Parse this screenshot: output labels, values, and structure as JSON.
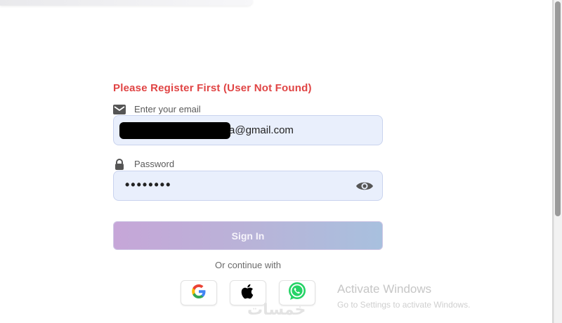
{
  "error_message": "Please Register First (User Not Found)",
  "email": {
    "label": "Enter your email",
    "icon": "mail-icon",
    "value_visible": "a@gmail.com"
  },
  "password": {
    "label": "Password",
    "icon": "lock-icon",
    "value": "••••••••",
    "toggle_icon": "eye-icon"
  },
  "signin_label": "Sign In",
  "or_text": "Or continue with",
  "social": [
    {
      "name": "google",
      "icon": "google-icon"
    },
    {
      "name": "apple",
      "icon": "apple-icon"
    },
    {
      "name": "whatsapp",
      "icon": "whatsapp-icon"
    }
  ],
  "windows_activation": {
    "title": "Activate Windows",
    "subtitle": "Go to Settings to activate Windows."
  },
  "watermark": "خمسات",
  "colors": {
    "error": "#e04444",
    "input_bg": "#e9effc",
    "button_from": "#c6a6d8",
    "button_to": "#a8c0de",
    "whatsapp": "#25d366"
  }
}
